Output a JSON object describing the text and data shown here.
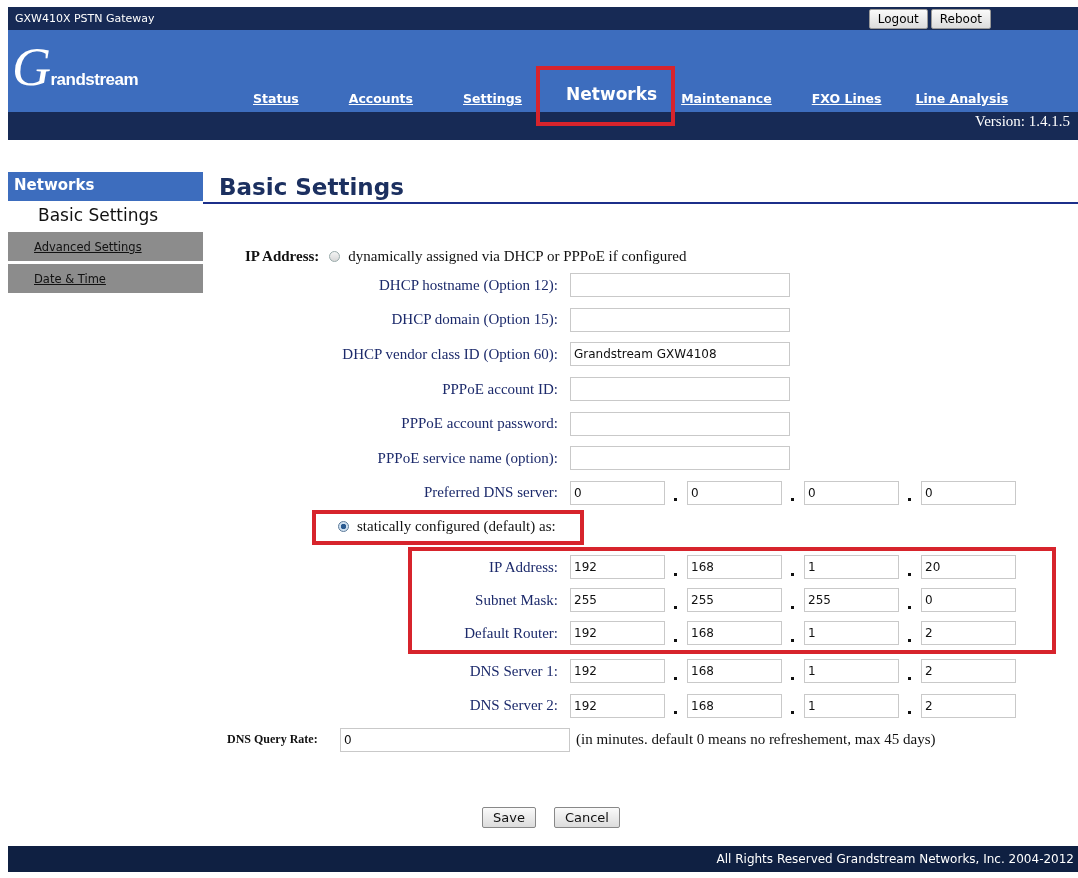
{
  "top_bar": {
    "title": "GXW410X PSTN Gateway",
    "buttons": [
      "Logout",
      "Reboot"
    ]
  },
  "logo": "Grandstream",
  "nav": [
    {
      "label": "Status",
      "selected": false,
      "highlighted": false
    },
    {
      "label": "Accounts",
      "selected": false,
      "highlighted": false
    },
    {
      "label": "Settings",
      "selected": false,
      "highlighted": false
    },
    {
      "label": "Networks",
      "selected": true,
      "highlighted": true
    },
    {
      "label": "Maintenance",
      "selected": false,
      "highlighted": false
    },
    {
      "label": "FXO Lines",
      "selected": false,
      "highlighted": false
    },
    {
      "label": "Line Analysis",
      "selected": false,
      "highlighted": false
    }
  ],
  "version": "Version: 1.4.1.5",
  "sidebar": {
    "title": "Networks",
    "items": [
      {
        "label": "Basic Settings",
        "selected": true
      },
      {
        "label": "Advanced Settings",
        "selected": false
      },
      {
        "label": "Date & Time",
        "selected": false
      }
    ]
  },
  "page_title": "Basic Settings",
  "ip_address": {
    "label": "IP Address:",
    "options": [
      {
        "label": "dynamically assigned via DHCP or PPPoE if configured",
        "selected": false,
        "highlighted": false
      },
      {
        "label": "statically configured (default) as:",
        "selected": true,
        "highlighted": true
      }
    ]
  },
  "dhcp_fields": [
    {
      "label": "DHCP hostname (Option 12):"
    },
    {
      "label": "DHCP domain (Option 15):"
    },
    {
      "label": "DHCP vendor class ID (Option 60):",
      "value": "Grandstream GXW4108"
    },
    {
      "label": "PPPoE account ID:"
    },
    {
      "label": "PPPoE account password:"
    },
    {
      "label": "PPPoE service name (option):"
    }
  ],
  "preferred_dns": {
    "label": "Preferred DNS server:",
    "octets": [
      "0",
      "0",
      "0",
      "0"
    ]
  },
  "static_group": {
    "highlighted": true,
    "fields": [
      {
        "label": "IP Address:",
        "octets": [
          "192",
          "168",
          "1",
          "20"
        ]
      },
      {
        "label": "Subnet Mask:",
        "octets": [
          "255",
          "255",
          "255",
          "0"
        ]
      },
      {
        "label": "Default Router:",
        "octets": [
          "192",
          "168",
          "1",
          "2"
        ]
      }
    ]
  },
  "dns_servers": [
    {
      "label": "DNS Server 1:",
      "octets": [
        "192",
        "168",
        "1",
        "2"
      ]
    },
    {
      "label": "DNS Server 2:",
      "octets": [
        "192",
        "168",
        "1",
        "2"
      ]
    }
  ],
  "dns_query_rate": {
    "label": "DNS Query Rate:",
    "value": "0",
    "hint": "(in minutes. default 0 means no refreshement, max 45 days)"
  },
  "buttons": [
    "Save",
    "Cancel"
  ],
  "footer": "All Rights Reserved Grandstream Networks, Inc. 2004-2012"
}
